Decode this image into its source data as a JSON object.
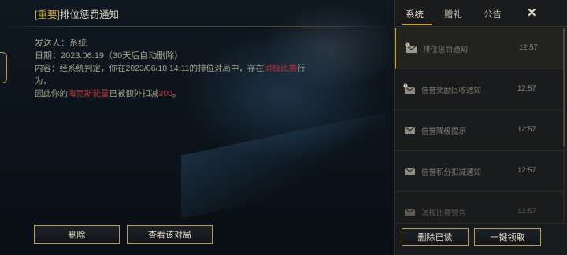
{
  "mail": {
    "title_tag": "[重要]",
    "title": "排位惩罚通知",
    "sender_label": "发送人：",
    "sender": "系统",
    "date_label": "日期：",
    "date": "2023.06.19（30天后自动删除）",
    "content_part1": "内容：经系统判定，你在2023/06/18 14:11的排位对局中，存在",
    "content_hl1": "消极比赛",
    "content_part2": "行为，",
    "content_part3": "因此你的",
    "content_hl2": "海克斯能量",
    "content_part4": "已被额外扣减",
    "content_hl3": "300",
    "content_part5": "。"
  },
  "buttons": {
    "delete": "删除",
    "view_match": "查看该对局",
    "delete_read": "删除已读",
    "claim_all": "一键领取"
  },
  "tabs": [
    {
      "label": "系统",
      "active": true
    },
    {
      "label": "赠礼",
      "active": false
    },
    {
      "label": "公告",
      "active": false
    }
  ],
  "close_icon": "close-icon",
  "messages": [
    {
      "name": "排位惩罚通知",
      "time": "12:57",
      "icon": "mail-alert-icon",
      "selected": true
    },
    {
      "name": "信誉奖励回收通知",
      "time": "12:57",
      "icon": "mail-alert-icon",
      "selected": false
    },
    {
      "name": "信誉降级提示",
      "time": "12:57",
      "icon": "mail-icon",
      "selected": false
    },
    {
      "name": "信誉积分扣减通知",
      "time": "12:57",
      "icon": "mail-icon",
      "selected": false
    },
    {
      "name": "消极比赛警告",
      "time": "12:57",
      "icon": "mail-icon",
      "selected": false
    }
  ],
  "colors": {
    "accent": "#c9a24a",
    "highlight": "#b8323c"
  }
}
